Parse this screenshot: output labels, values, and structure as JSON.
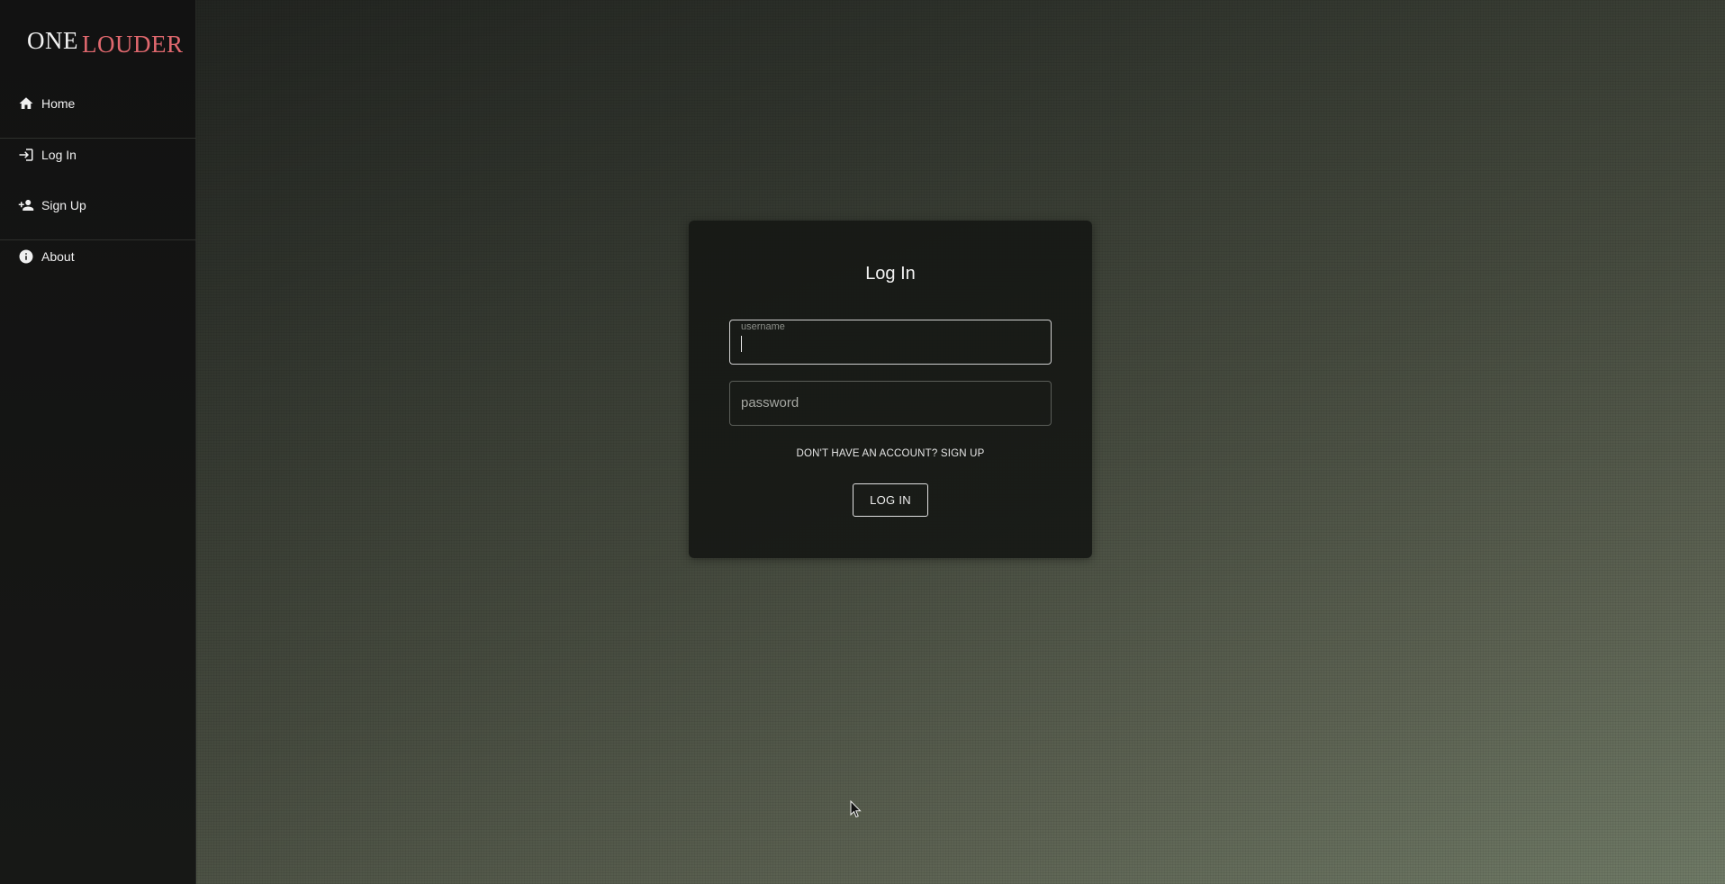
{
  "sidebar": {
    "logo": {
      "part1": "ONE",
      "part2": "LOUDER"
    },
    "items": [
      {
        "label": "Home",
        "icon": "home-icon"
      },
      {
        "label": "Log In",
        "icon": "login-icon"
      },
      {
        "label": "Sign Up",
        "icon": "person-add-icon"
      },
      {
        "label": "About",
        "icon": "info-icon"
      }
    ]
  },
  "login_card": {
    "title": "Log In",
    "username": {
      "label": "username",
      "value": ""
    },
    "password": {
      "placeholder": "password",
      "value": ""
    },
    "signup_link": "DON'T HAVE AN ACCOUNT? SIGN UP",
    "submit_label": "LOG IN"
  },
  "colors": {
    "logo_accent": "#e0686e",
    "sidebar_bg": "#121212",
    "card_bg": "#161815"
  }
}
